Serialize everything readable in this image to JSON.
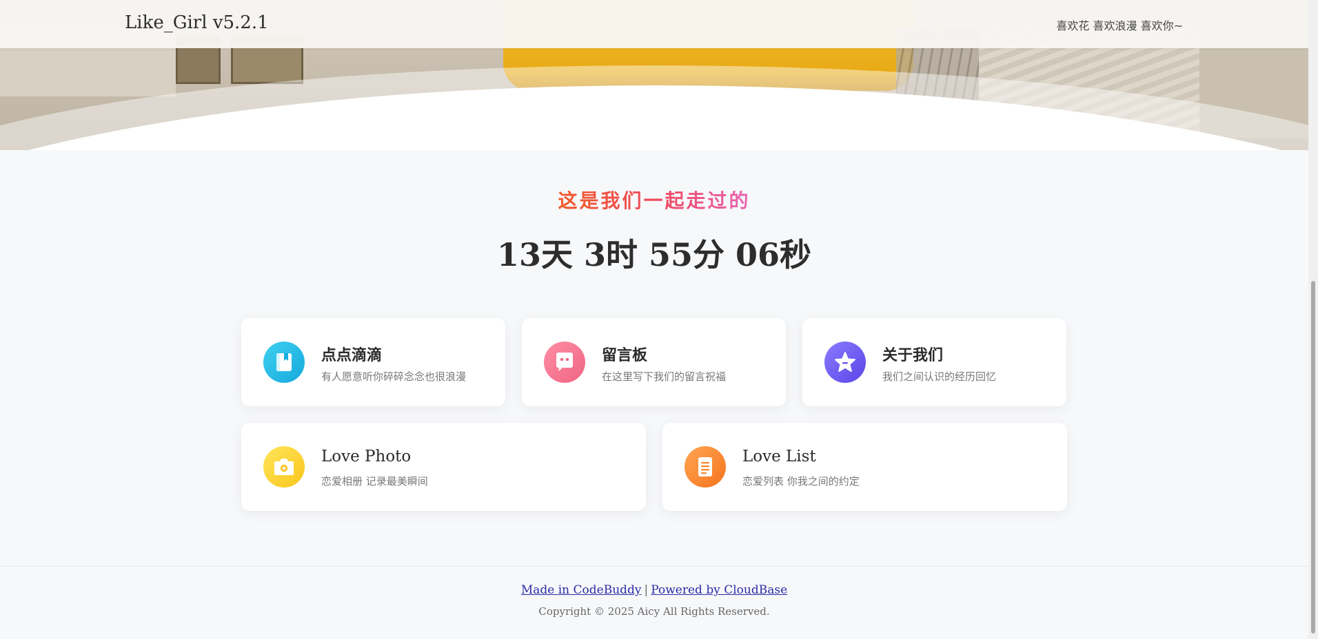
{
  "header": {
    "brand": "Like_Girl v5.2.1",
    "slogan": "喜欢花 喜欢浪漫 喜欢你~"
  },
  "counter": {
    "subtitle": "这是我们一起走过的",
    "elapsed": "13天 3时 55分 06秒"
  },
  "cards": [
    {
      "title": "点点滴滴",
      "desc": "有人愿意听你碎碎念念也很浪漫",
      "icon": "notebook-icon",
      "color": "#1fb6e3"
    },
    {
      "title": "留言板",
      "desc": "在这里写下我们的留言祝福",
      "icon": "chat-face-icon",
      "color": "#f4738e"
    },
    {
      "title": "关于我们",
      "desc": "我们之间认识的经历回忆",
      "icon": "star-icon",
      "color": "#6a55ef"
    },
    {
      "title": "Love Photo",
      "desc": "恋爱相册 记录最美瞬间",
      "icon": "camera-icon",
      "color": "#fbd233"
    },
    {
      "title": "Love List",
      "desc": "恋爱列表 你我之间的约定",
      "icon": "document-list-icon",
      "color": "#f7852e"
    }
  ],
  "footer": {
    "made_in": "Made in CodeBuddy",
    "separator": "|",
    "powered_by": "Powered by CloudBase",
    "copyright": "Copyright © 2025 Aicy All Rights Reserved."
  }
}
